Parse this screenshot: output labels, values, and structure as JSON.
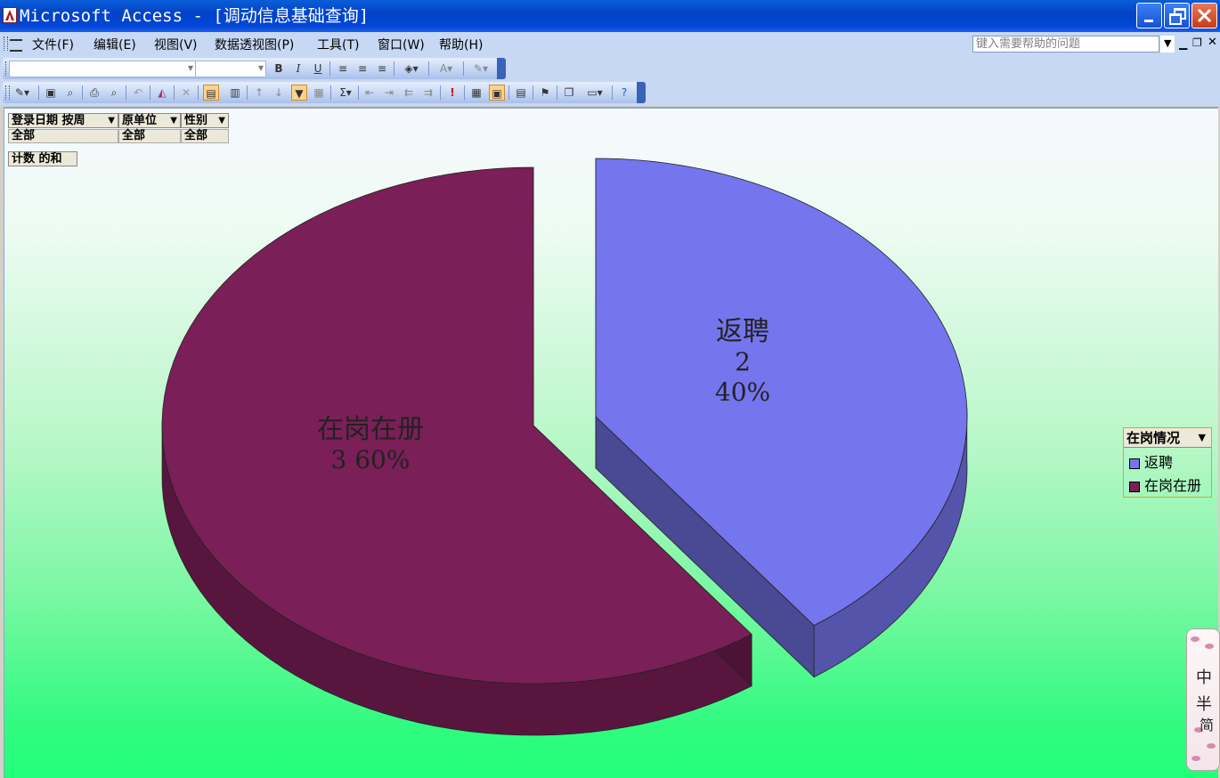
{
  "window": {
    "title": "Microsoft Access - [调动信息基础查询]"
  },
  "menu": {
    "items": [
      "文件(F)",
      "编辑(E)",
      "视图(V)",
      "数据透视图(P)",
      "工具(T)",
      "窗口(W)",
      "帮助(H)"
    ],
    "help_placeholder": "键入需要帮助的问题"
  },
  "filters": {
    "fields": [
      {
        "label": "登录日期 按周",
        "value": "全部"
      },
      {
        "label": "原单位",
        "value": "全部"
      },
      {
        "label": "性别",
        "value": "全部"
      }
    ],
    "data_field": "计数 的和"
  },
  "chart_data": {
    "type": "pie",
    "categories": [
      "返聘",
      "在岗在册"
    ],
    "values": [
      2,
      3
    ],
    "percents": [
      "40%",
      "60%"
    ],
    "colors": [
      "#7575ee",
      "#7a1f58"
    ],
    "legend_title": "在岗情况",
    "legend_position": "right"
  },
  "ime": {
    "chars": [
      "中",
      "半",
      "简"
    ]
  }
}
